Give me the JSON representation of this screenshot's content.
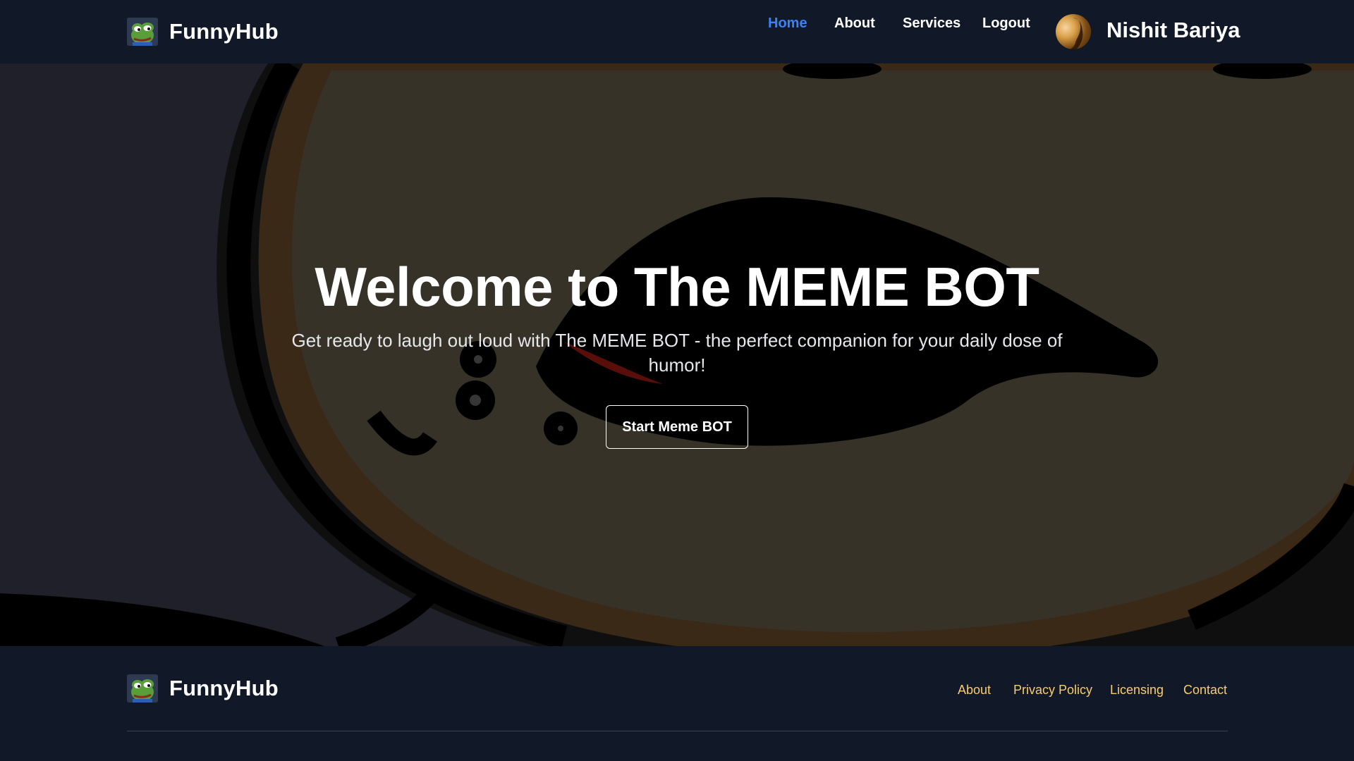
{
  "nav": {
    "brand": "FunnyHub",
    "links": [
      {
        "label": "Home",
        "active": true
      },
      {
        "label": "About",
        "active": false
      },
      {
        "label": "Services",
        "active": false
      },
      {
        "label": "Logout",
        "active": false
      }
    ],
    "user_name": "Nishit Bariya",
    "active_color": "#3b82f6"
  },
  "hero": {
    "title": "Welcome to The MEME BOT",
    "subtitle": "Get ready to laugh out loud with The MEME BOT - the perfect companion for your daily dose of humor!",
    "cta_label": "Start Meme BOT"
  },
  "footer": {
    "brand": "FunnyHub",
    "links": [
      "About",
      "Privacy Policy",
      "Licensing",
      "Contact"
    ],
    "link_color": "#facc6b"
  },
  "icons": {
    "logo": "pepe-frog-logo-icon",
    "avatar": "user-avatar-image"
  },
  "colors": {
    "background": "#111827",
    "hero_overlay": "rgba(0,0,0,0.5)"
  }
}
